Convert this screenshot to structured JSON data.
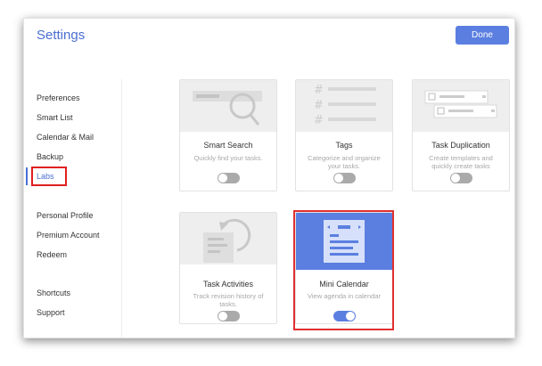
{
  "header": {
    "title": "Settings",
    "done_label": "Done"
  },
  "sidebar": {
    "items": [
      {
        "label": "Preferences"
      },
      {
        "label": "Smart List"
      },
      {
        "label": "Calendar & Mail"
      },
      {
        "label": "Backup"
      },
      {
        "label": "Labs"
      },
      {
        "label": "Personal Profile"
      },
      {
        "label": "Premium Account"
      },
      {
        "label": "Redeem"
      },
      {
        "label": "Shortcuts"
      },
      {
        "label": "Support"
      }
    ],
    "active": "Labs"
  },
  "labs": {
    "features": [
      {
        "name": "Smart Search",
        "description": "Quickly find your tasks.",
        "icon": "magnifier-icon",
        "enabled": false
      },
      {
        "name": "Tags",
        "description": "Categorize and organize your tasks.",
        "icon": "hashtag-icon",
        "enabled": false
      },
      {
        "name": "Task Duplication",
        "description": "Create templates and quickly create tasks",
        "icon": "duplicate-icon",
        "enabled": false
      },
      {
        "name": "Task Activities",
        "description": "Track revision history of tasks.",
        "icon": "history-icon",
        "enabled": false
      },
      {
        "name": "Mini Calendar",
        "description": "View agenda in calendar",
        "icon": "calendar-icon",
        "enabled": true
      }
    ]
  },
  "colors": {
    "accent": "#5b7fe0",
    "highlight": "#e03030"
  }
}
